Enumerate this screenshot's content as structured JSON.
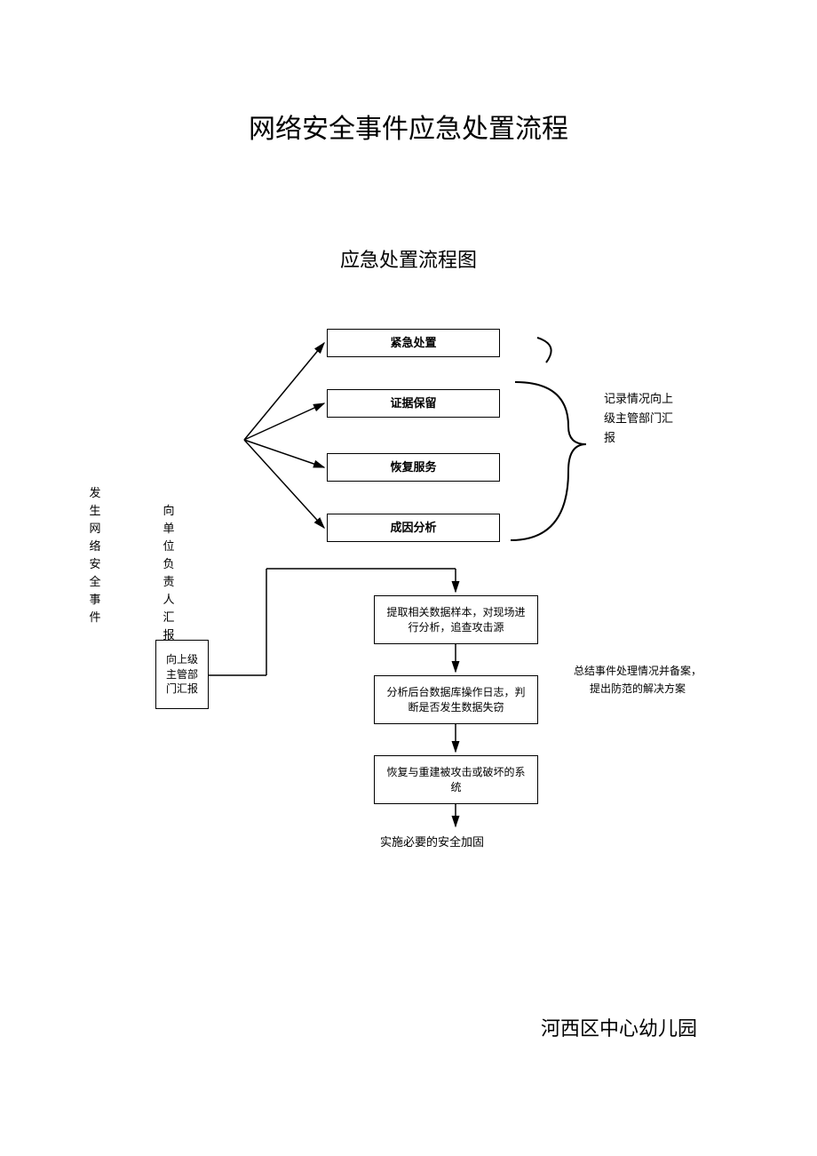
{
  "title": "网络安全事件应急处置流程",
  "subtitle": "应急处置流程图",
  "leftCol1": "发生网络安全事件",
  "leftCol2": "向单位负责人汇报",
  "boxes": {
    "emergency": "紧急处置",
    "evidence": "证据保留",
    "recovery": "恢复服务",
    "analysis": "成因分析"
  },
  "reportBox": "向上级主管部门汇报",
  "detail1": "提取相关数据样本，对现场进行分析，追查攻击源",
  "detail2": "分析后台数据库操作日志，判断是否发生数据失窃",
  "detail3": "恢复与重建被攻击或破坏的系统",
  "sideRight1": "记录情况向上级主管部门汇报",
  "sideRight2": "总结事件处理情况并备案，提出防范的解决方案",
  "bottomLabel": "实施必要的安全加固",
  "footer": "河西区中心幼儿园"
}
